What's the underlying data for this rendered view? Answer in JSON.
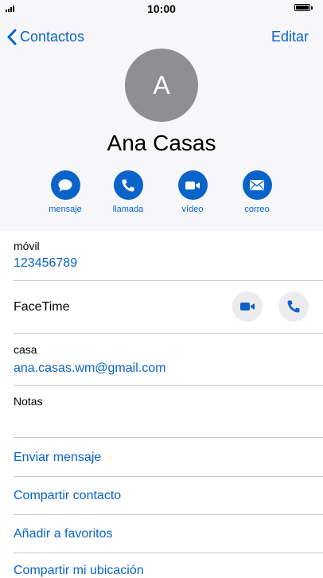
{
  "status_bar": {
    "time": "10:00"
  },
  "nav": {
    "back_label": "Contactos",
    "edit_label": "Editar"
  },
  "contact": {
    "initial": "A",
    "name": "Ana Casas",
    "actions": [
      {
        "label": "mensaje",
        "icon": "message-icon"
      },
      {
        "label": "llamada",
        "icon": "phone-icon"
      },
      {
        "label": "vídeo",
        "icon": "video-icon"
      },
      {
        "label": "correo",
        "icon": "mail-icon"
      }
    ]
  },
  "fields": {
    "mobile": {
      "label": "móvil",
      "value": "123456789"
    },
    "facetime": {
      "label": "FaceTime"
    },
    "email": {
      "label": "casa",
      "value": "ana.casas.wm@gmail.com"
    },
    "notes": {
      "label": "Notas"
    }
  },
  "links": [
    "Enviar mensaje",
    "Compartir contacto",
    "Añadir a favoritos",
    "Compartir mi ubicación"
  ],
  "colors": {
    "accent": "#0a63c9",
    "avatar": "#8e8e93",
    "header_bg": "#f7f7f9"
  }
}
